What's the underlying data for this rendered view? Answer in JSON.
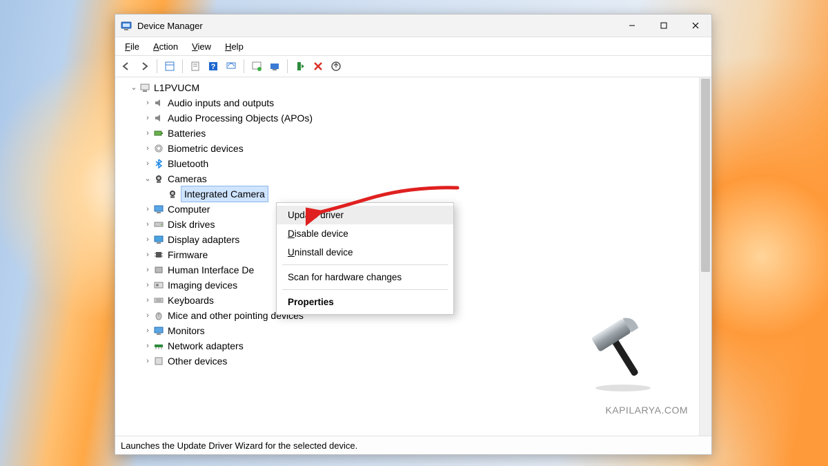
{
  "window": {
    "title": "Device Manager"
  },
  "menu": {
    "file": "File",
    "action": "Action",
    "view": "View",
    "help": "Help"
  },
  "tree": {
    "root": "L1PVUCM",
    "items": [
      {
        "label": "Audio inputs and outputs"
      },
      {
        "label": "Audio Processing Objects (APOs)"
      },
      {
        "label": "Batteries"
      },
      {
        "label": "Biometric devices"
      },
      {
        "label": "Bluetooth"
      },
      {
        "label": "Cameras",
        "expanded": true
      },
      {
        "label": "Computer"
      },
      {
        "label": "Disk drives"
      },
      {
        "label": "Display adapters"
      },
      {
        "label": "Firmware"
      },
      {
        "label": "Human Interface Devices"
      },
      {
        "label": "Imaging devices"
      },
      {
        "label": "Keyboards"
      },
      {
        "label": "Mice and other pointing devices"
      },
      {
        "label": "Monitors"
      },
      {
        "label": "Network adapters"
      },
      {
        "label": "Other devices"
      }
    ],
    "camera_child": "Integrated Camera",
    "human_interface_truncated": "Human Interface De"
  },
  "context_menu": {
    "update": "Update driver",
    "disable": "Disable device",
    "uninstall": "Uninstall device",
    "scan": "Scan for hardware changes",
    "properties": "Properties"
  },
  "status_bar": "Launches the Update Driver Wizard for the selected device.",
  "watermark": "KAPILARYA.COM"
}
